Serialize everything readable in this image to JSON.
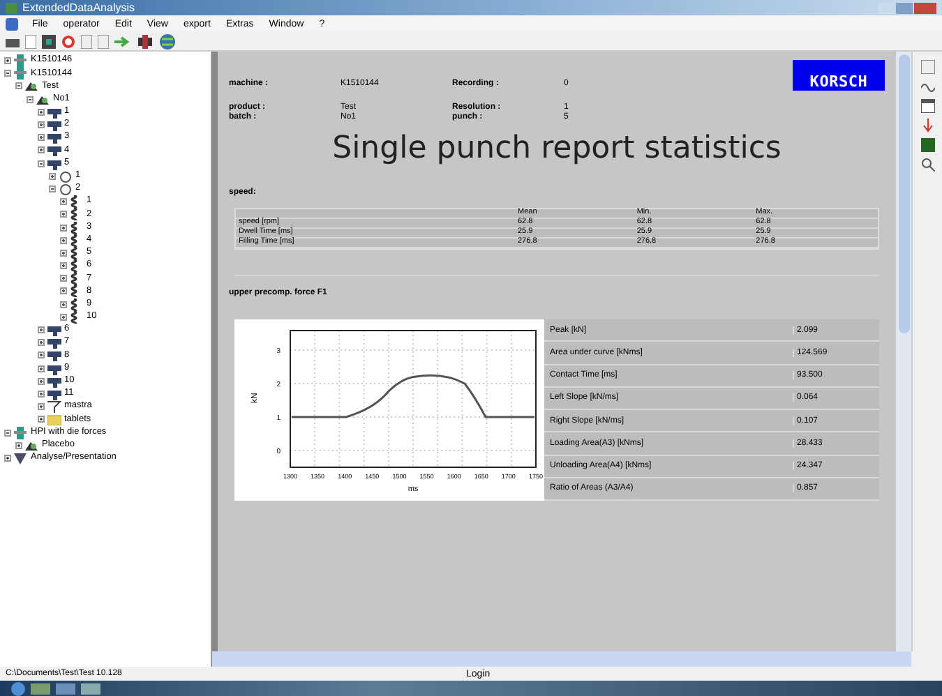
{
  "window": {
    "title": "ExtendedDataAnalysis"
  },
  "menu": [
    "File",
    "operator",
    "Edit",
    "View",
    "export",
    "Extras",
    "Window",
    "?"
  ],
  "tree": [
    {
      "label": "K1510146",
      "kind": "machine",
      "expanded": false
    },
    {
      "label": "K1510144",
      "kind": "machine",
      "expanded": true,
      "children": [
        {
          "label": "Test",
          "kind": "product",
          "expanded": true,
          "children": [
            {
              "label": "No1",
              "kind": "product",
              "expanded": true,
              "children": [
                {
                  "label": "1",
                  "kind": "punch",
                  "expanded": false
                },
                {
                  "label": "2",
                  "kind": "punch",
                  "expanded": false
                },
                {
                  "label": "3",
                  "kind": "punch",
                  "expanded": false
                },
                {
                  "label": "4",
                  "kind": "punch",
                  "expanded": false
                },
                {
                  "label": "5",
                  "kind": "punch",
                  "expanded": true,
                  "children": [
                    {
                      "label": "1",
                      "kind": "ring",
                      "expanded": false
                    },
                    {
                      "label": "2",
                      "kind": "ring",
                      "expanded": true,
                      "children": [
                        {
                          "label": "1",
                          "kind": "spring",
                          "expanded": false
                        },
                        {
                          "label": "2",
                          "kind": "spring",
                          "expanded": false
                        },
                        {
                          "label": "3",
                          "kind": "spring",
                          "expanded": false
                        },
                        {
                          "label": "4",
                          "kind": "spring",
                          "expanded": false
                        },
                        {
                          "label": "5",
                          "kind": "spring",
                          "expanded": false
                        },
                        {
                          "label": "6",
                          "kind": "spring",
                          "expanded": false
                        },
                        {
                          "label": "7",
                          "kind": "spring",
                          "expanded": false
                        },
                        {
                          "label": "8",
                          "kind": "spring",
                          "expanded": false
                        },
                        {
                          "label": "9",
                          "kind": "spring",
                          "expanded": false
                        },
                        {
                          "label": "10",
                          "kind": "spring",
                          "expanded": false
                        }
                      ]
                    }
                  ]
                },
                {
                  "label": "6",
                  "kind": "punch",
                  "expanded": false
                },
                {
                  "label": "7",
                  "kind": "punch",
                  "expanded": false
                },
                {
                  "label": "8",
                  "kind": "punch",
                  "expanded": false
                },
                {
                  "label": "9",
                  "kind": "punch",
                  "expanded": false
                },
                {
                  "label": "10",
                  "kind": "punch",
                  "expanded": false
                },
                {
                  "label": "11",
                  "kind": "punch",
                  "expanded": false
                },
                {
                  "label": "mastra",
                  "kind": "funnel",
                  "expanded": false
                },
                {
                  "label": "tablets",
                  "kind": "folder",
                  "expanded": false
                }
              ]
            }
          ]
        }
      ]
    },
    {
      "label": "HPI with die forces",
      "kind": "machine",
      "expanded": true,
      "children": [
        {
          "label": "Placebo",
          "kind": "product",
          "expanded": false
        }
      ]
    },
    {
      "label": "Analyse/Presentation",
      "kind": "analysis",
      "expanded": false
    }
  ],
  "report": {
    "info": [
      {
        "label": "machine :",
        "value": "K1510144"
      },
      {
        "label": "Recording :",
        "value": "0"
      },
      {
        "label": "product :",
        "value": "Test"
      },
      {
        "label": "Resolution :",
        "value": "1"
      },
      {
        "label": "batch :",
        "value": "No1"
      },
      {
        "label": "punch :",
        "value": "5"
      }
    ],
    "logo": "KORSCH",
    "title": "Single punch report statistics",
    "speed": {
      "heading": "speed:",
      "columns": [
        "",
        "Mean",
        "Min.",
        "Max."
      ],
      "rows": [
        [
          "speed [rpm]",
          "62.8",
          "62.8",
          "62.8"
        ],
        [
          "Dwell Time [ms]",
          "25.9",
          "25.9",
          "25.9"
        ],
        [
          "Filling Time [ms]",
          "276.8",
          "276.8",
          "276.8"
        ]
      ]
    },
    "force": {
      "heading": "upper precomp. force F1",
      "ylabel": "kN",
      "xlabel": "ms",
      "yticks": [
        "3",
        "2",
        "1",
        "0"
      ],
      "xticks": [
        "1300",
        "1350",
        "1400",
        "1450",
        "1500",
        "1550",
        "1600",
        "1650",
        "1700",
        "1750"
      ],
      "stats": [
        [
          "Peak [kN]",
          "2.099"
        ],
        [
          "Area under curve [kNms]",
          "124.569"
        ],
        [
          "Contact Time [ms]",
          "93.500"
        ],
        [
          "Left Slope [kN/ms]",
          "0.064"
        ],
        [
          "Right Slope [kN/ms]",
          "0.107"
        ],
        [
          "Loading Area(A3) [kNms]",
          "28.433"
        ],
        [
          "Unloading Area(A4) [kNms]",
          "24.347"
        ],
        [
          "Ratio of Areas (A3/A4)",
          "0.857"
        ]
      ]
    }
  },
  "status_bar": {
    "path": "C:\\Documents\\Test\\Test 10.128",
    "login": "Login"
  }
}
